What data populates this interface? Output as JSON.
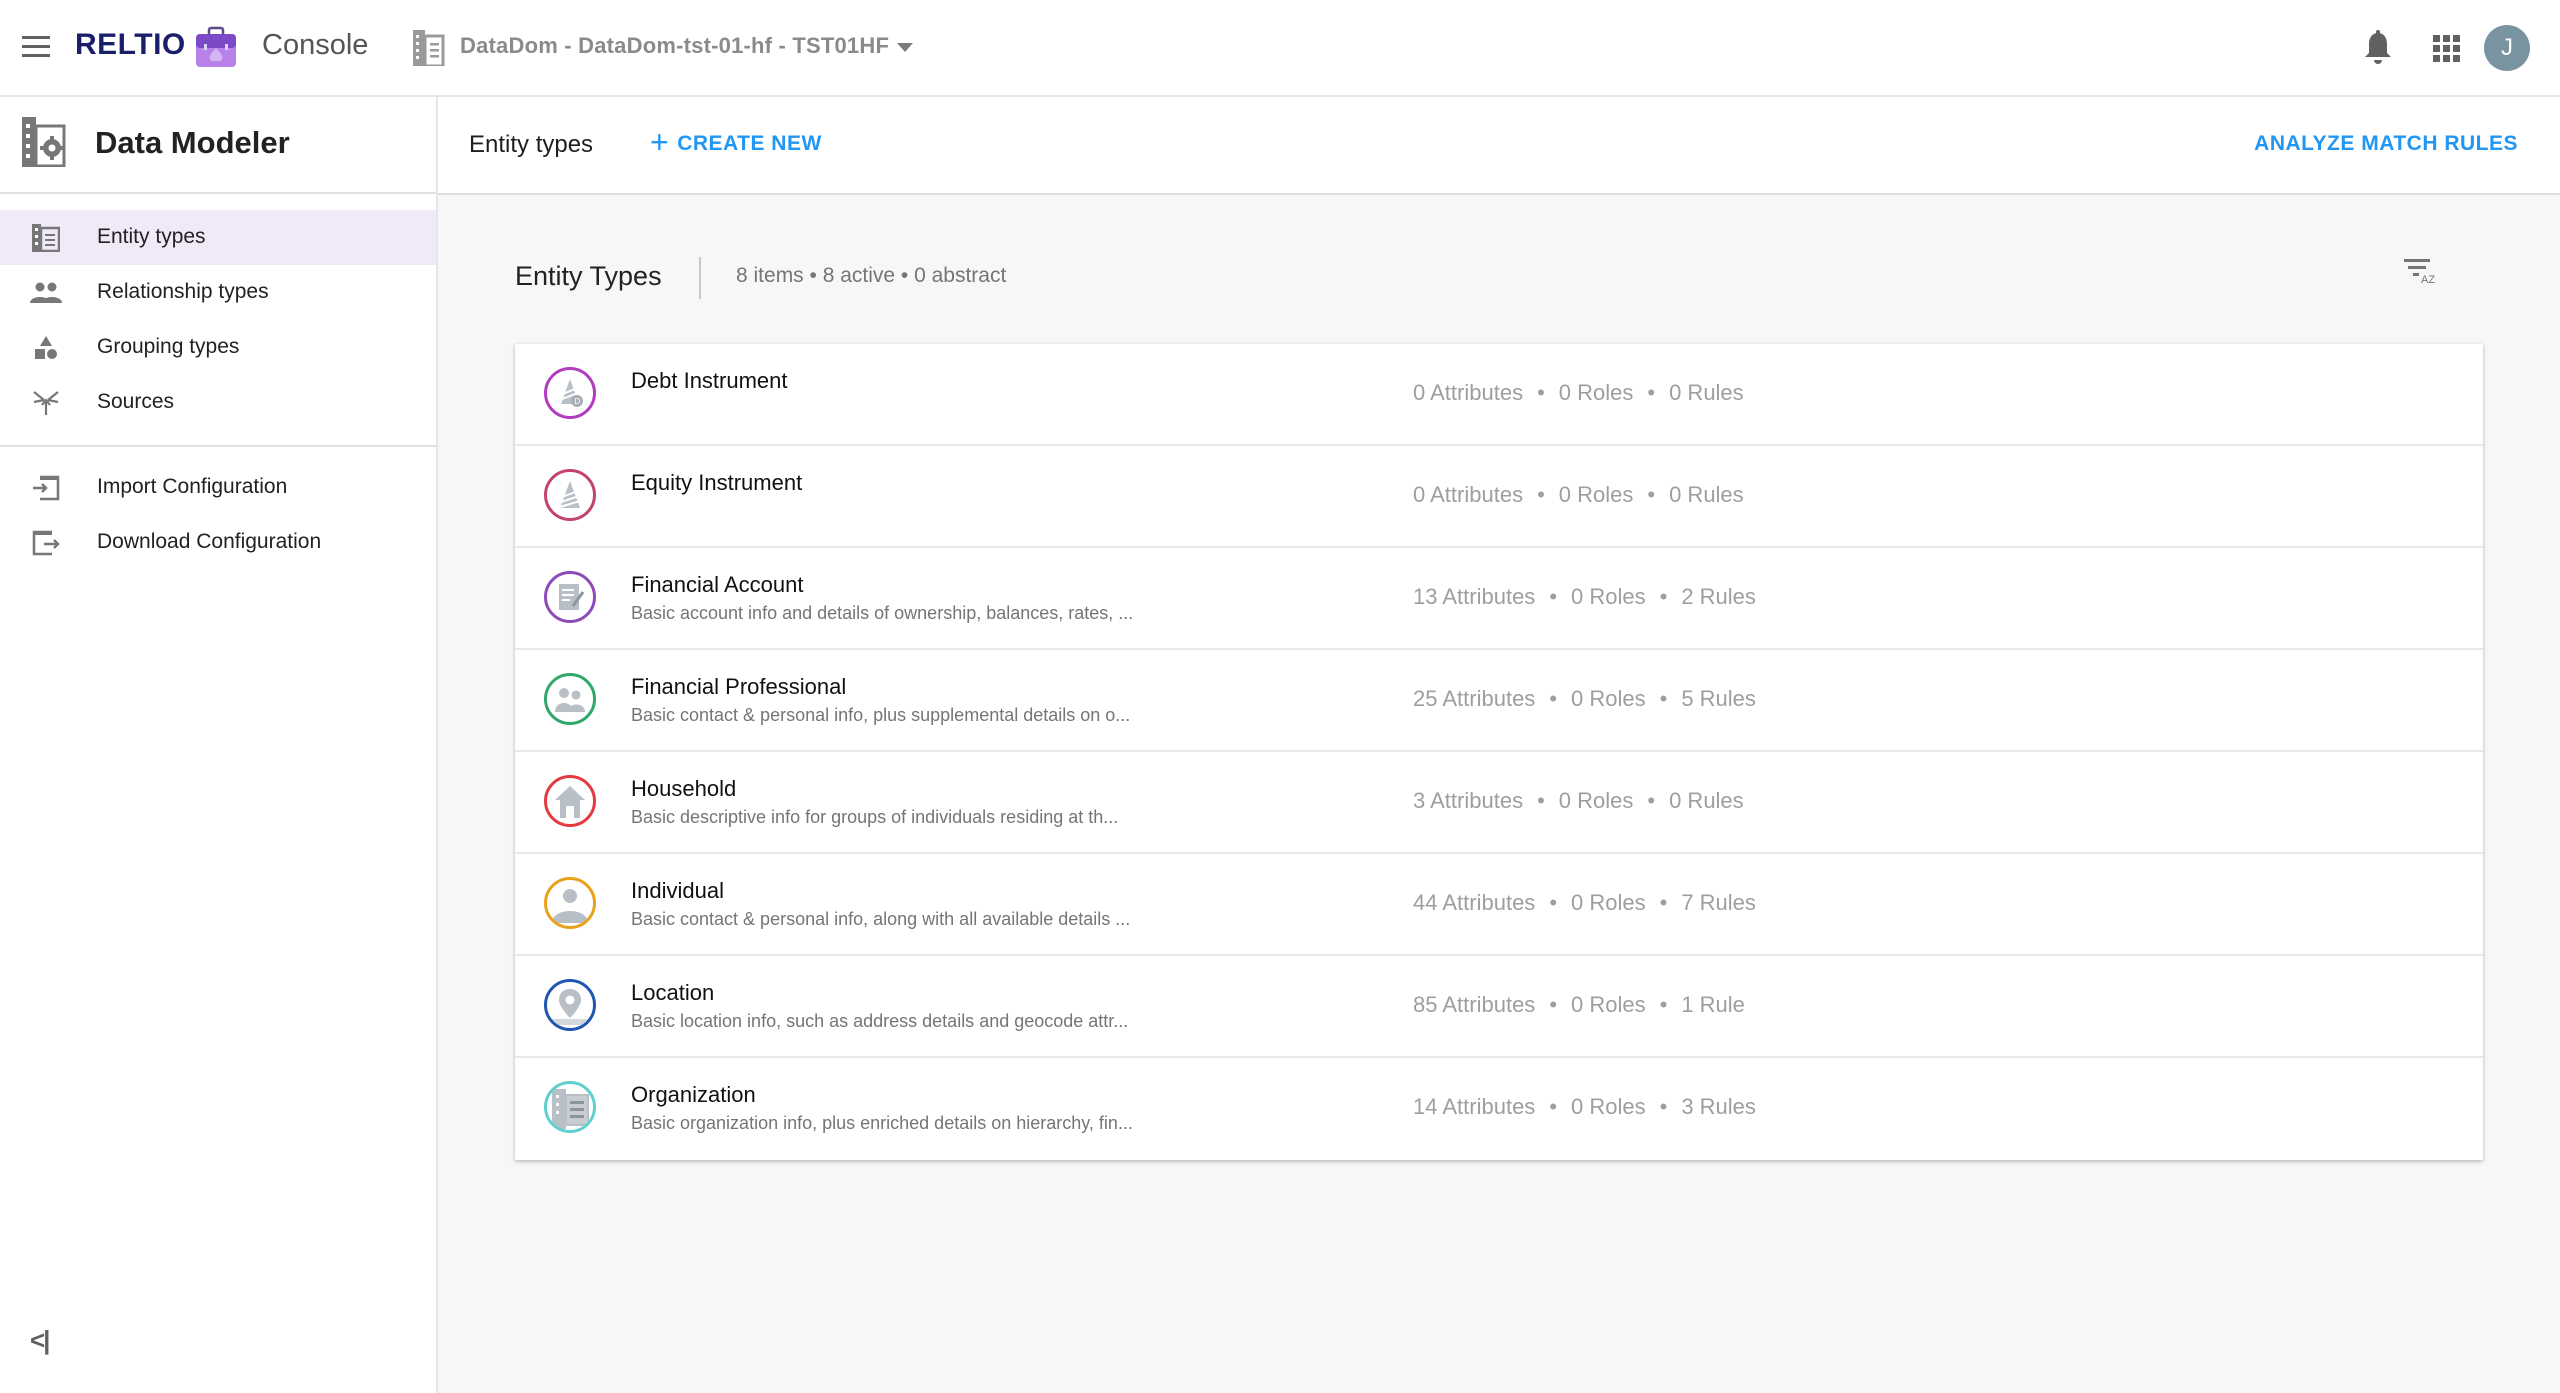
{
  "topbar": {
    "menu_icon": "hamburger-menu-icon",
    "logo": "RELTIO",
    "app_name": "Console",
    "tenant": "DataDom - DataDom-tst-01-hf - TST01HF",
    "avatar_initial": "J"
  },
  "sidebar": {
    "title": "Data Modeler",
    "items": [
      {
        "label": "Entity types",
        "icon": "entity-types-icon",
        "active": true
      },
      {
        "label": "Relationship types",
        "icon": "people-icon",
        "active": false
      },
      {
        "label": "Grouping types",
        "icon": "shapes-icon",
        "active": false
      },
      {
        "label": "Sources",
        "icon": "merge-icon",
        "active": false
      }
    ],
    "config_items": [
      {
        "label": "Import Configuration",
        "icon": "import-icon"
      },
      {
        "label": "Download Configuration",
        "icon": "download-icon"
      }
    ],
    "collapse_label": "<|"
  },
  "header": {
    "title": "Entity types",
    "create_new": "CREATE NEW",
    "create_new_icon": "+",
    "analyze": "ANALYZE MATCH RULES"
  },
  "section": {
    "title": "Entity Types",
    "count": "8 items • 8 active • 0 abstract"
  },
  "colors": {
    "accent": "#2196f3",
    "active_nav_bg": "#f0eaf8"
  },
  "entities": [
    {
      "name": "Debt Instrument",
      "description": "",
      "attributes": "0 Attributes",
      "roles": "0 Roles",
      "rules": "0 Rules",
      "ring": "#b23cc0",
      "icon": "debt-instrument-icon"
    },
    {
      "name": "Equity Instrument",
      "description": "",
      "attributes": "0 Attributes",
      "roles": "0 Roles",
      "rules": "0 Rules",
      "ring": "#c2446a",
      "icon": "equity-instrument-icon"
    },
    {
      "name": "Financial Account",
      "description": "Basic account info and details of ownership, balances, rates, ...",
      "attributes": "13 Attributes",
      "roles": "0 Roles",
      "rules": "2 Rules",
      "ring": "#8e4bb8",
      "icon": "financial-account-icon"
    },
    {
      "name": "Financial Professional",
      "description": "Basic contact & personal info, plus supplemental details on o...",
      "attributes": "25 Attributes",
      "roles": "0 Roles",
      "rules": "5 Rules",
      "ring": "#2fa86a",
      "icon": "financial-professional-icon"
    },
    {
      "name": "Household",
      "description": "Basic descriptive info for groups of individuals residing at th...",
      "attributes": "3 Attributes",
      "roles": "0 Roles",
      "rules": "0 Rules",
      "ring": "#e53940",
      "icon": "household-icon"
    },
    {
      "name": "Individual",
      "description": "Basic contact & personal info, along with all available details ...",
      "attributes": "44 Attributes",
      "roles": "0 Roles",
      "rules": "7 Rules",
      "ring": "#e8a21a",
      "icon": "individual-icon"
    },
    {
      "name": "Location",
      "description": "Basic location info, such as address details and geocode attr...",
      "attributes": "85 Attributes",
      "roles": "0 Roles",
      "rules": "1 Rule",
      "ring": "#1f56b0",
      "icon": "location-icon"
    },
    {
      "name": "Organization",
      "description": "Basic organization info, plus enriched details on hierarchy, fin...",
      "attributes": "14 Attributes",
      "roles": "0 Roles",
      "rules": "3 Rules",
      "ring": "#5fcfcf",
      "icon": "organization-icon"
    }
  ]
}
